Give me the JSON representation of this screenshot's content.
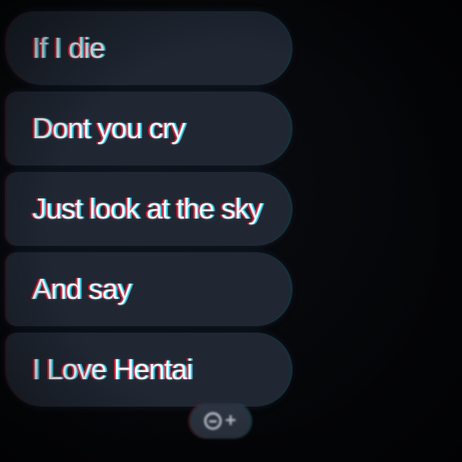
{
  "messages": [
    {
      "text": "If I die"
    },
    {
      "text": "Dont you cry"
    },
    {
      "text": "Just look at the sky"
    },
    {
      "text": "And say"
    },
    {
      "text": "I Love Hentai"
    }
  ],
  "reaction_button": {
    "icons": [
      "add-emoji-icon",
      "plus-icon"
    ],
    "plus_glyph": "+"
  },
  "colors": {
    "background": "#050608",
    "bubble": "#202733",
    "text": "#f4f6f8",
    "reaction": "#2b3340"
  }
}
